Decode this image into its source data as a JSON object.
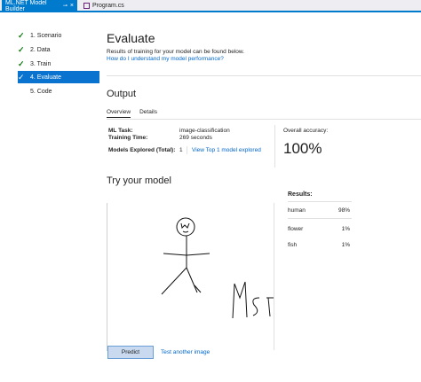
{
  "tabs": [
    {
      "label": "ML.NET Model Builder",
      "active": true,
      "pin": "⊸",
      "close": "×"
    },
    {
      "label": "Program.cs",
      "active": false
    }
  ],
  "sidebar": {
    "steps": [
      {
        "label": "1. Scenario",
        "done": true
      },
      {
        "label": "2. Data",
        "done": true
      },
      {
        "label": "3. Train",
        "done": true
      },
      {
        "label": "4. Evaluate",
        "done": true,
        "active": true
      },
      {
        "label": "5. Code",
        "done": false
      }
    ]
  },
  "main": {
    "title": "Evaluate",
    "description": "Results of training for your model can be found below.",
    "help_link": "How do I understand my model performance?",
    "output": {
      "heading": "Output",
      "tabs": [
        "Overview",
        "Details"
      ],
      "ml_task_label": "ML Task:",
      "ml_task_value": "image-classification",
      "training_time_label": "Training Time:",
      "training_time_value": "269 seconds",
      "models_explored_label": "Models Explored (Total):",
      "models_explored_value": "1",
      "view_models_link": "View Top 1 model explored",
      "accuracy_label": "Overall accuracy:",
      "accuracy_value": "100%"
    },
    "try": {
      "heading": "Try your model",
      "results_title": "Results:",
      "results": [
        {
          "label": "human",
          "value": "98%"
        },
        {
          "label": "flower",
          "value": "1%"
        },
        {
          "label": "fish",
          "value": "1%"
        }
      ],
      "image_text": "MsIsn",
      "predict_button": "Predict",
      "test_link": "Test another image"
    }
  },
  "colors": {
    "accent": "#007acc",
    "check": "#107c10",
    "link": "#0066cc",
    "selected": "#0a73d0"
  }
}
